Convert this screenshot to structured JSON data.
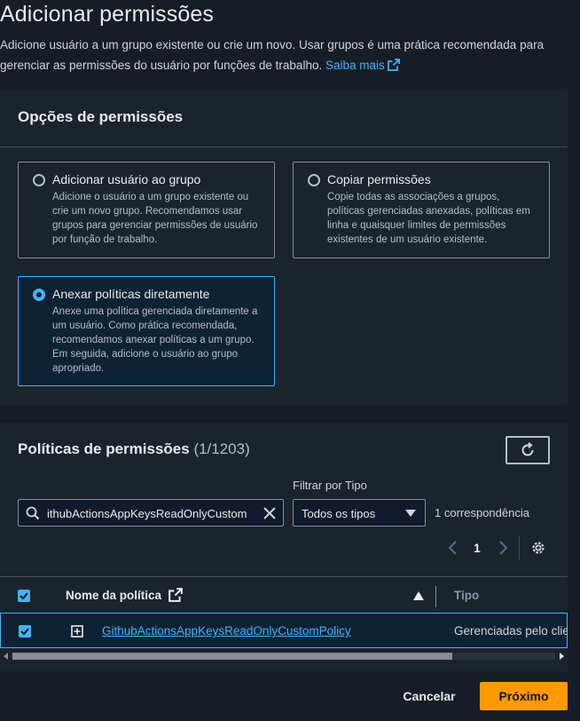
{
  "header": {
    "title": "Adicionar permissões",
    "description": "Adicione usuário a um grupo existente ou crie um novo. Usar grupos é uma prática recomendada para gerenciar as permissões do usuário por funções de trabalho.",
    "learn_more": "Saiba mais"
  },
  "options_panel": {
    "title": "Opções de permissões",
    "options": [
      {
        "title": "Adicionar usuário ao grupo",
        "description": "Adicione o usuário a um grupo existente ou crie um novo grupo. Recomendamos usar grupos para gerenciar permissões de usuário por função de trabalho.",
        "selected": false
      },
      {
        "title": "Copiar permissões",
        "description": "Copie todas as associações a grupos, políticas gerenciadas anexadas, políticas em linha e quaisquer limites de permissões existentes de um usuário existente.",
        "selected": false
      },
      {
        "title": "Anexar políticas diretamente",
        "description": "Anexe uma política gerenciada diretamente a um usuário. Como prática recomendada, recomendamos anexar políticas a um grupo. Em seguida, adicione o usuário ao grupo apropriado.",
        "selected": true
      }
    ]
  },
  "policies_panel": {
    "title": "Políticas de permissões",
    "count": "(1/1203)",
    "search_value": "ithubActionsAppKeysReadOnlyCustom",
    "filter_label": "Filtrar por Tipo",
    "filter_value": "Todos os tipos",
    "matches": "1 correspondência",
    "page": "1",
    "columns": {
      "name": "Nome da política",
      "type": "Tipo"
    },
    "rows": [
      {
        "name": "GithubActionsAppKeysReadOnlyCustomPolicy",
        "type": "Gerenciadas pelo cliente",
        "checked": true
      }
    ]
  },
  "footer": {
    "cancel": "Cancelar",
    "next": "Próximo"
  },
  "colors": {
    "background": "#161d26",
    "panel": "#1b232d",
    "accent": "#42b4ff",
    "primary_button": "#ff9900"
  }
}
